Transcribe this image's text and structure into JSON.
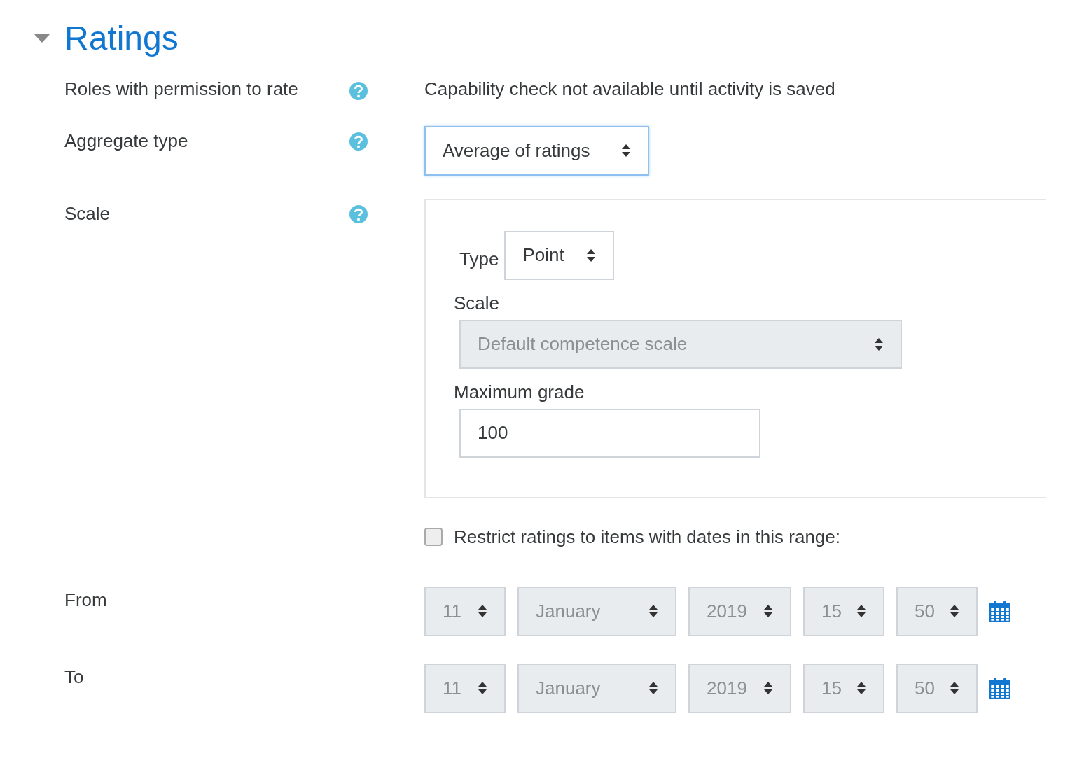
{
  "section": {
    "title": "Ratings",
    "expanded": true
  },
  "roles": {
    "label": "Roles with permission to rate",
    "value": "Capability check not available until activity is saved"
  },
  "aggregate": {
    "label": "Aggregate type",
    "select": {
      "value": "Average of ratings",
      "focused": true
    }
  },
  "scale": {
    "label": "Scale",
    "type_label": "Type",
    "type_select": {
      "value": "Point",
      "disabled": false
    },
    "scale_label": "Scale",
    "scale_select": {
      "value": "Default competence scale",
      "disabled": true
    },
    "max_grade_label": "Maximum grade",
    "max_grade_input": {
      "value": "100"
    }
  },
  "restrict": {
    "label": "Restrict ratings to items with dates in this range:",
    "checked": false
  },
  "dates": [
    {
      "label": "From",
      "fields": [
        {
          "value": "11",
          "disabled": true
        },
        {
          "value": "January",
          "disabled": true
        },
        {
          "value": "2019",
          "disabled": true
        },
        {
          "value": "15",
          "disabled": true
        },
        {
          "value": "50",
          "disabled": true
        }
      ]
    },
    {
      "label": "To",
      "fields": [
        {
          "value": "11",
          "disabled": true
        },
        {
          "value": "January",
          "disabled": true
        },
        {
          "value": "2019",
          "disabled": true
        },
        {
          "value": "15",
          "disabled": true
        },
        {
          "value": "50",
          "disabled": true
        }
      ]
    }
  ]
}
